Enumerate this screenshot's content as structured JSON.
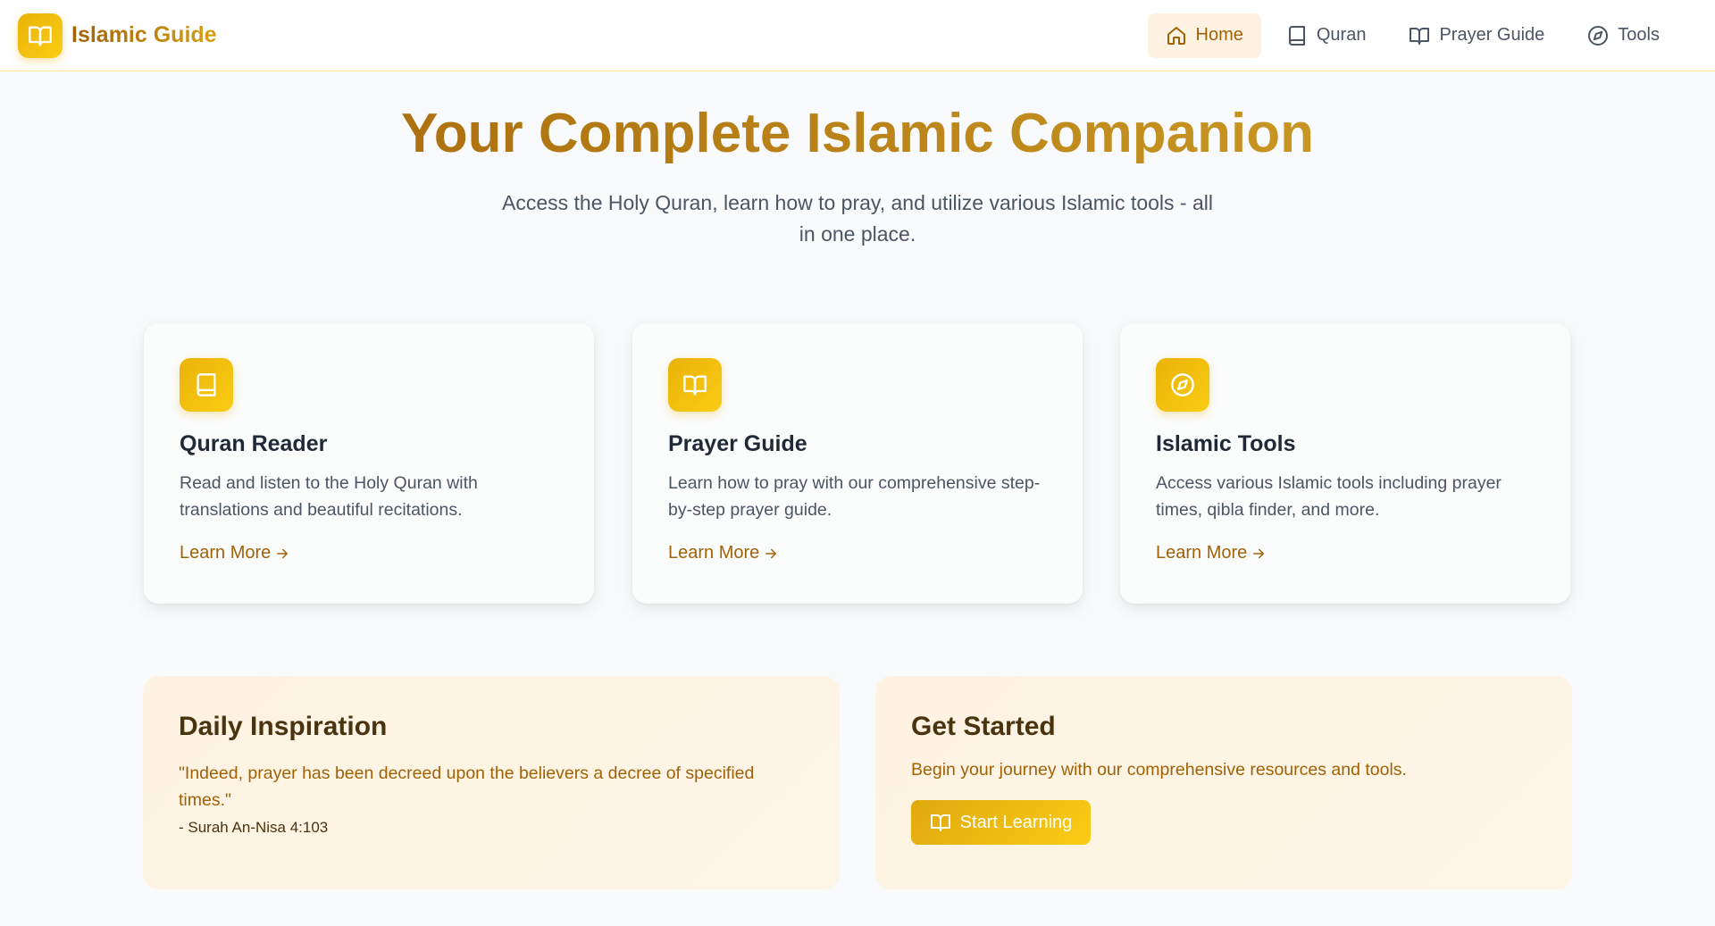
{
  "brand": {
    "name": "Islamic Guide",
    "icon": "book-open-icon"
  },
  "nav": [
    {
      "label": "Home",
      "icon": "home-icon",
      "active": true
    },
    {
      "label": "Quran",
      "icon": "book-icon",
      "active": false
    },
    {
      "label": "Prayer Guide",
      "icon": "book-open-icon",
      "active": false
    },
    {
      "label": "Tools",
      "icon": "compass-icon",
      "active": false
    }
  ],
  "hero": {
    "title": "Your Complete Islamic Companion",
    "subtitle": "Access the Holy Quran, learn how to pray, and utilize various Islamic tools - all in one place."
  },
  "cards": [
    {
      "icon": "book-icon",
      "title": "Quran Reader",
      "description": "Read and listen to the Holy Quran with translations and beautiful recitations.",
      "link": "Learn More"
    },
    {
      "icon": "book-open-icon",
      "title": "Prayer Guide",
      "description": "Learn how to pray with our comprehensive step-by-step prayer guide.",
      "link": "Learn More"
    },
    {
      "icon": "compass-icon",
      "title": "Islamic Tools",
      "description": "Access various Islamic tools including prayer times, qibla finder, and more.",
      "link": "Learn More"
    }
  ],
  "inspiration": {
    "title": "Daily Inspiration",
    "quote": "\"Indeed, prayer has been decreed upon the believers a decree of specified times.\"",
    "source": "- Surah An-Nisa 4:103"
  },
  "get_started": {
    "title": "Get Started",
    "description": "Begin your journey with our comprehensive resources and tools.",
    "button_label": "Start Learning"
  },
  "colors": {
    "accent": "#eab308",
    "accent_dark": "#a16207",
    "panel_bg": "#fef3e2"
  }
}
